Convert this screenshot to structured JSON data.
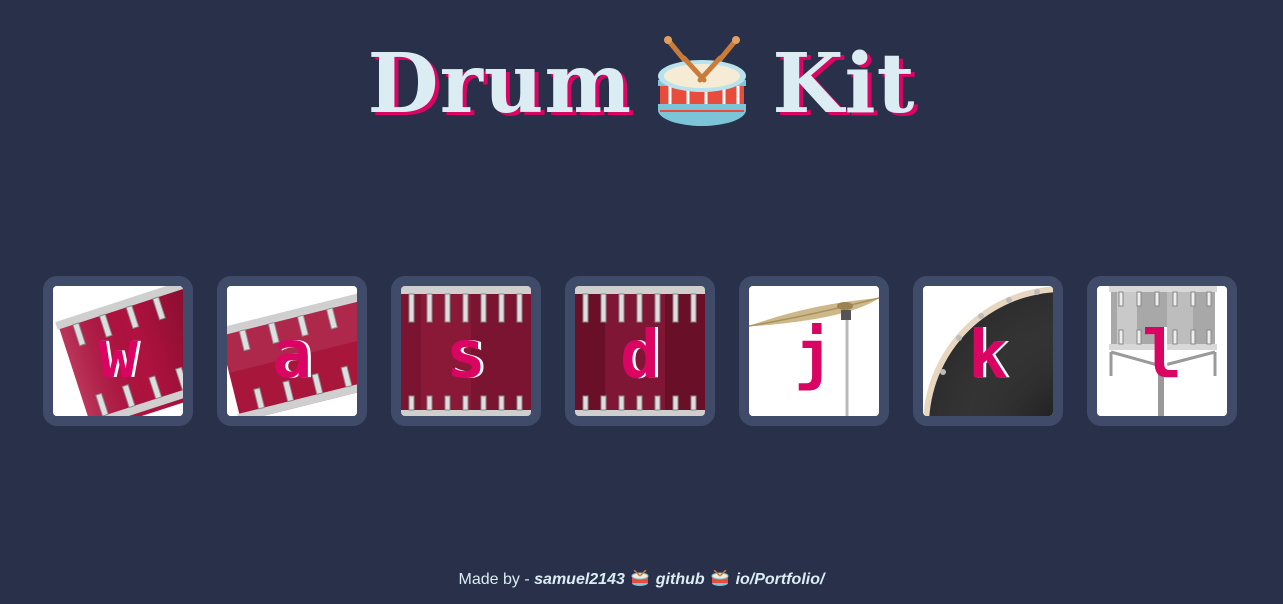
{
  "header": {
    "title_left": "Drum",
    "title_right": "Kit",
    "title_icon": "drum-icon"
  },
  "drums": [
    {
      "key": "w",
      "icon": "tom-1-drum"
    },
    {
      "key": "a",
      "icon": "tom-2-drum"
    },
    {
      "key": "s",
      "icon": "tom-3-drum"
    },
    {
      "key": "d",
      "icon": "tom-4-drum"
    },
    {
      "key": "j",
      "icon": "crash-cymbal"
    },
    {
      "key": "k",
      "icon": "kick-bass-drum"
    },
    {
      "key": "l",
      "icon": "snare-drum"
    }
  ],
  "footer": {
    "prefix": "Made by - ",
    "author": "samuel2143",
    "link_github": "github",
    "link_portfolio": "io/Portfolio/",
    "separator_icon": "drum-icon"
  },
  "colors": {
    "background": "#283149",
    "button_border": "#404b69",
    "accent": "#da0463",
    "text_light": "#dbedf3"
  }
}
